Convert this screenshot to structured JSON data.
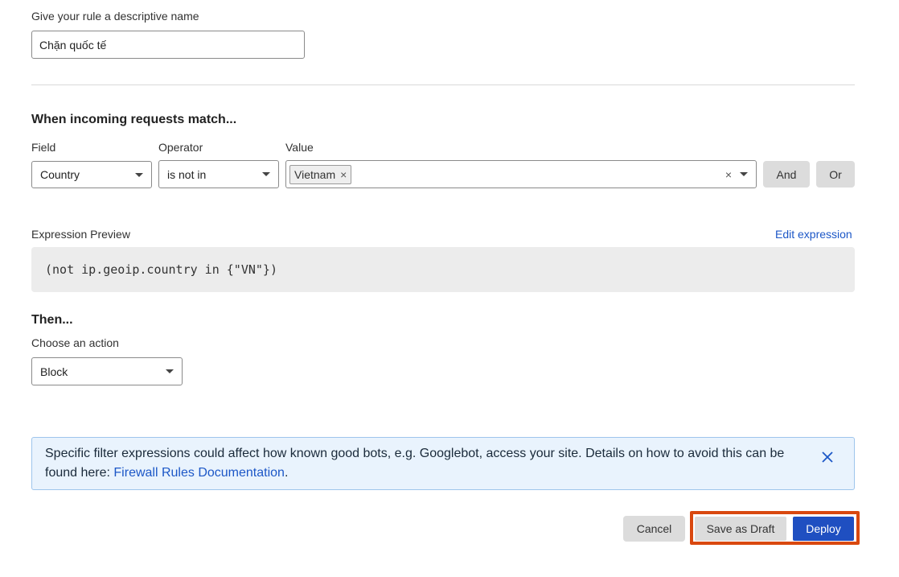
{
  "rule_name": {
    "label": "Give your rule a descriptive name",
    "value": "Chặn quốc tế"
  },
  "match": {
    "heading": "When incoming requests match...",
    "field_label": "Field",
    "operator_label": "Operator",
    "value_label": "Value",
    "field_value": "Country",
    "operator_value": "is not in",
    "value_chips": [
      "Vietnam"
    ],
    "and_label": "And",
    "or_label": "Or"
  },
  "expression": {
    "label": "Expression Preview",
    "edit_link": "Edit expression",
    "code": "(not ip.geoip.country in {\"VN\"})"
  },
  "then": {
    "heading": "Then...",
    "action_label": "Choose an action",
    "action_value": "Block"
  },
  "notice": {
    "text": "Specific filter expressions could affect how known good bots, e.g. Googlebot, access your site. Details on how to avoid this can be found here: ",
    "link_text": "Firewall Rules Documentation",
    "suffix": "."
  },
  "footer": {
    "cancel_label": "Cancel",
    "save_draft_label": "Save as Draft",
    "deploy_label": "Deploy"
  },
  "colors": {
    "primary": "#1f4fc1",
    "highlight_border": "#d9480f",
    "link": "#1c57c7"
  }
}
